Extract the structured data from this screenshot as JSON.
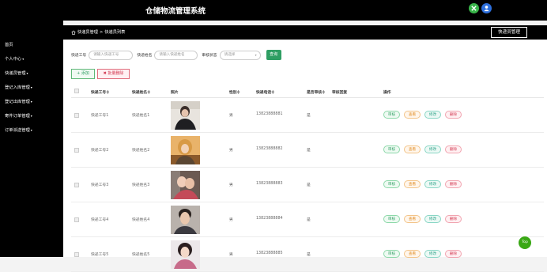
{
  "app": {
    "title": "仓储物流管理系统"
  },
  "header": {
    "icons": [
      {
        "name": "close-icon",
        "color": "#39b54a"
      },
      {
        "name": "user-icon",
        "color": "#2d6fdc"
      }
    ]
  },
  "sidebar": {
    "items": [
      {
        "label": "首页",
        "caret": ""
      },
      {
        "label": "个人中心",
        "caret": "▾"
      },
      {
        "label": "快递员管理",
        "caret": "▾"
      },
      {
        "label": "登记入库管理",
        "caret": "▾"
      },
      {
        "label": "登记出库管理",
        "caret": "▾"
      },
      {
        "label": "寄件订单管理",
        "caret": "▾"
      },
      {
        "label": "订单派送管理",
        "caret": "▾"
      }
    ]
  },
  "breadcrumb": {
    "home": "快递员管理",
    "sep": ">",
    "current": "快递员列表"
  },
  "mgmt_button": "快递员管理",
  "search": {
    "worker_id_label": "快递工号",
    "worker_id_placeholder": "请输入快递工号",
    "worker_name_label": "快递姓名",
    "worker_name_placeholder": "请输入快递姓名",
    "status_label": "审核状态",
    "status_value": "请选择",
    "status_arrow": "▾",
    "search_button": "查询"
  },
  "actions": {
    "add": "+ 添加",
    "batch_delete": "✖ 批量删除"
  },
  "table": {
    "headers": [
      "快递工号≑",
      "快递姓名≑",
      "照片",
      "性别≑",
      "快递电话≑",
      "是否审核≑",
      "审核回复",
      "操作"
    ],
    "op_labels": {
      "audit": "审核",
      "view": "查看",
      "edit": "修改",
      "delete": "删除"
    },
    "rows": [
      {
        "id": "快递工号1",
        "name": "快递姓名1",
        "gender": "男",
        "phone": "13823888881",
        "audited": "是",
        "reply": ""
      },
      {
        "id": "快递工号2",
        "name": "快递姓名2",
        "gender": "男",
        "phone": "13823888882",
        "audited": "是",
        "reply": ""
      },
      {
        "id": "快递工号3",
        "name": "快递姓名3",
        "gender": "男",
        "phone": "13823888883",
        "audited": "是",
        "reply": ""
      },
      {
        "id": "快递工号4",
        "name": "快递姓名4",
        "gender": "男",
        "phone": "13823888884",
        "audited": "是",
        "reply": ""
      },
      {
        "id": "快递工号5",
        "name": "快递姓名5",
        "gender": "男",
        "phone": "13823888885",
        "audited": "是",
        "reply": ""
      }
    ]
  },
  "colors": {
    "accent": "#2f9e63",
    "danger": "#d1364f",
    "top_button": "#3aa815"
  },
  "top_button": "Top"
}
